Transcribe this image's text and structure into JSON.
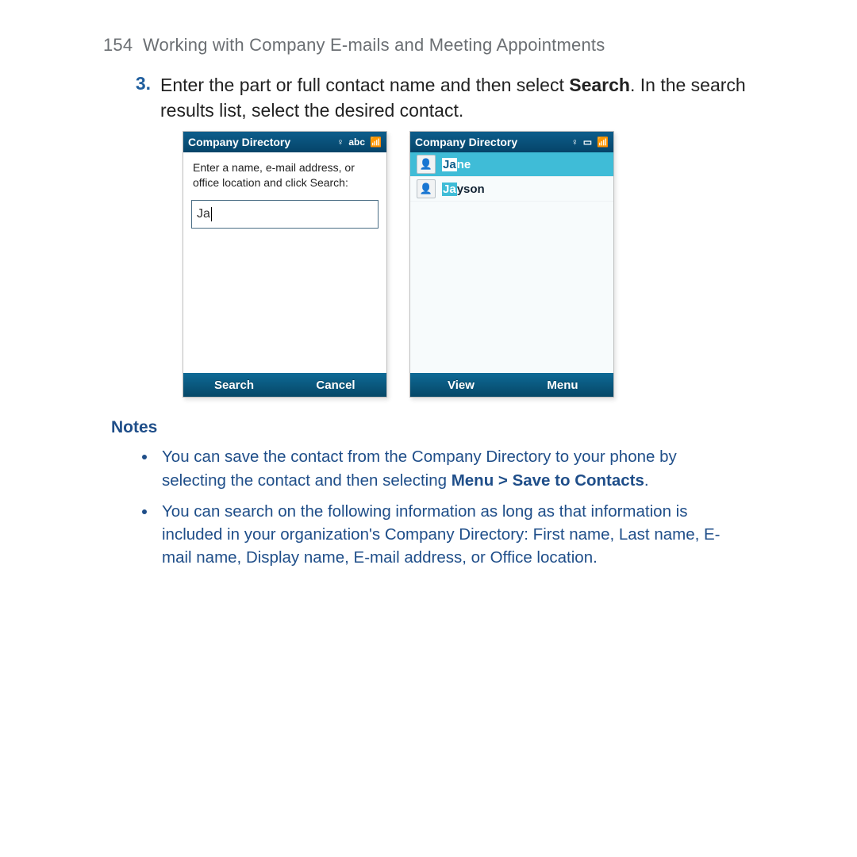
{
  "header": {
    "page_number": "154",
    "chapter_title": "Working with Company E-mails and Meeting Appointments"
  },
  "step": {
    "number": "3.",
    "text_before_bold": "Enter the part or full contact name and then select ",
    "bold_word": "Search",
    "text_after_bold": ". In the search results list, select the desired contact."
  },
  "screen_left": {
    "title": "Company Directory",
    "status_text": "abc",
    "instructions": "Enter a name, e-mail address, or office location and click Search:",
    "input_value": "Ja",
    "softkey_left": "Search",
    "softkey_right": "Cancel"
  },
  "screen_right": {
    "title": "Company Directory",
    "results": [
      {
        "highlight": "Ja",
        "rest": "ne",
        "selected": true
      },
      {
        "highlight": "Ja",
        "rest": "yson",
        "selected": false
      }
    ],
    "softkey_left": "View",
    "softkey_right": "Menu"
  },
  "notes": {
    "heading": "Notes",
    "items": [
      {
        "pre": "You can save the contact from the Company Directory to your phone by selecting the contact and then selecting ",
        "bold": "Menu > Save to Contacts",
        "post": "."
      },
      {
        "pre": "You can search on the following information as long as that information is included in your organization's Company Directory: First name, Last name, E-mail name, Display name, E-mail address, or Office location.",
        "bold": "",
        "post": ""
      }
    ]
  }
}
